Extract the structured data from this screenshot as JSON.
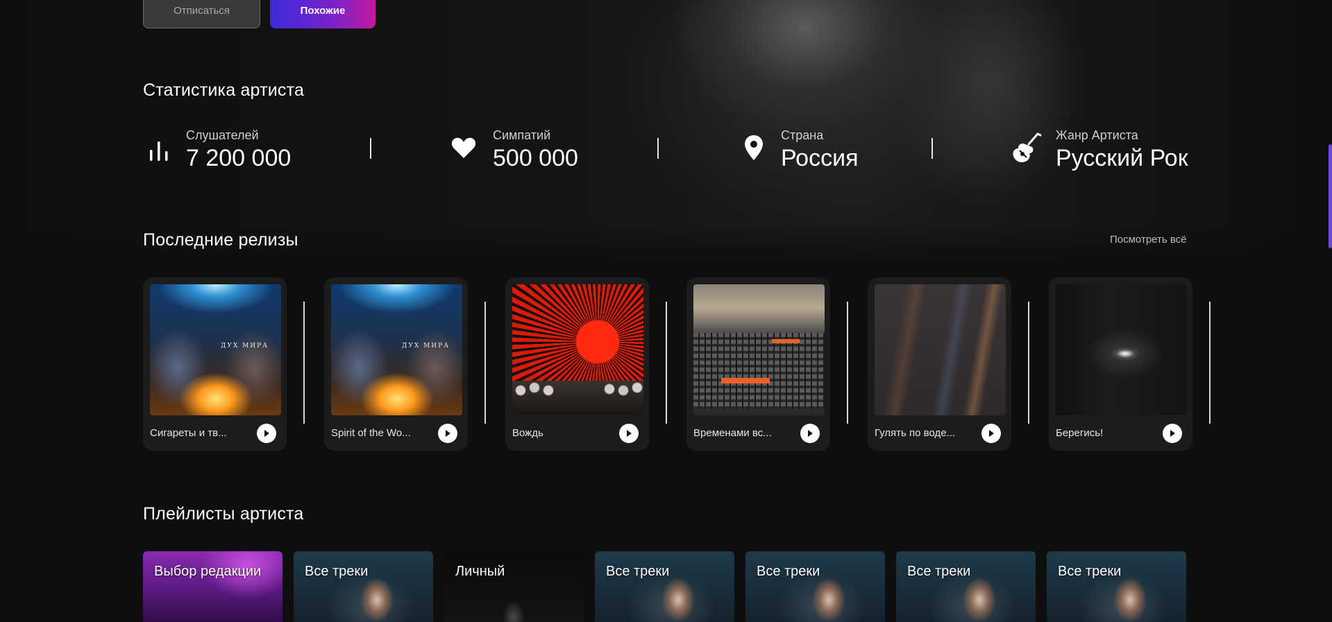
{
  "actions": {
    "unsubscribe_label": "Отписаться",
    "similar_label": "Похожие"
  },
  "stats": {
    "title": "Статистика артиста",
    "items": [
      {
        "label": "Слушателей",
        "value": "7 200 000",
        "icon": "bars-chart-icon"
      },
      {
        "label": "Симпатий",
        "value": "500 000",
        "icon": "heart-icon"
      },
      {
        "label": "Страна",
        "value": "Россия",
        "icon": "location-pin-icon"
      },
      {
        "label": "Жанр Артиста",
        "value": "Русский Рок",
        "icon": "electric-guitar-icon"
      }
    ]
  },
  "releases": {
    "title": "Последние релизы",
    "see_all_label": "Посмотреть всё",
    "items": [
      {
        "name": "Сигареты и тв...",
        "cover_text": "ДУХ МИРА"
      },
      {
        "name": "Spirit of the Wo...",
        "cover_text": "ДУХ МИРА"
      },
      {
        "name": "Вождь"
      },
      {
        "name": "Временами вс..."
      },
      {
        "name": "Гулять по воде..."
      },
      {
        "name": "Берегись!"
      }
    ]
  },
  "playlists": {
    "title": "Плейлисты артиста",
    "items": [
      {
        "name": "Выбор редакции"
      },
      {
        "name": "Все треки"
      },
      {
        "name": "Личный"
      },
      {
        "name": "Все треки"
      },
      {
        "name": "Все треки"
      },
      {
        "name": "Все треки"
      },
      {
        "name": "Все треки"
      }
    ]
  },
  "colors": {
    "background": "#0e0e0e",
    "card": "#1c1c1c",
    "accent_gradient_start": "#3c2ad8",
    "accent_gradient_end": "#c31a9e",
    "scrollbar": "#6b4bd8"
  }
}
